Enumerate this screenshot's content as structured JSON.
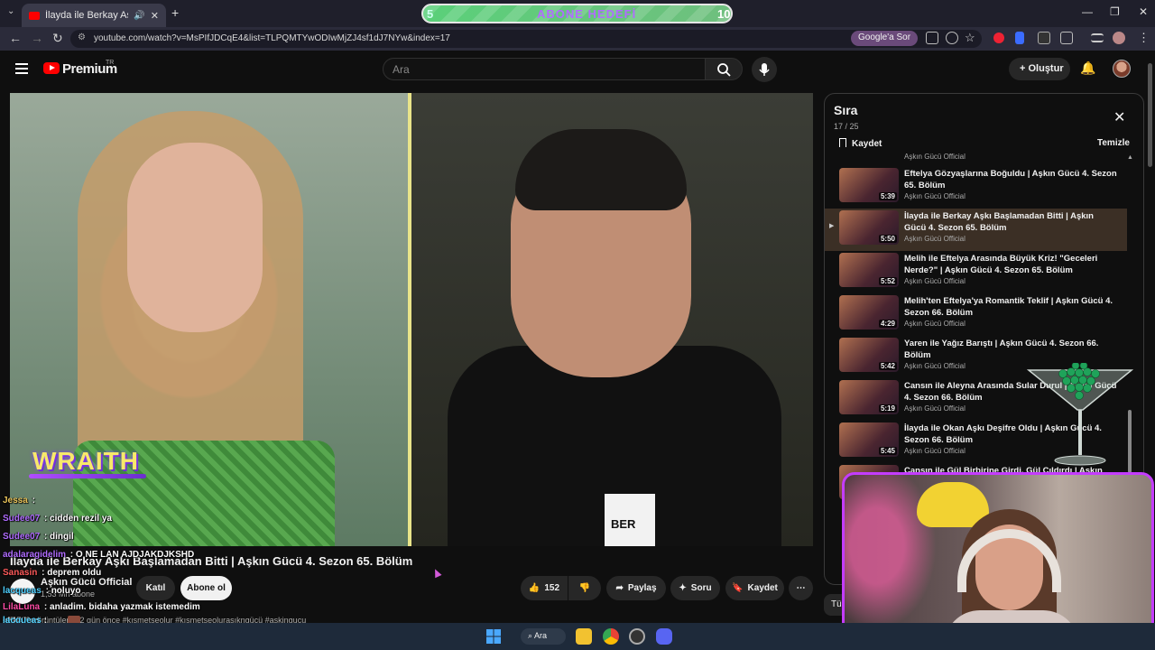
{
  "browser": {
    "tab_title": "İlayda ile Berkay Aşkı Başla",
    "url": "youtube.com/watch?v=MsPIfJDCqE4&list=TLPQMTYwODIwMjZJ4sf1dJ7NYw&index=17",
    "google_sor": "Google'a Sor"
  },
  "sub_goal": {
    "left": "5",
    "label": "ABONE HEDEFİ",
    "right": "10"
  },
  "header": {
    "logo": "Premium",
    "region": "TR",
    "search_placeholder": "Ara",
    "create_label": "Oluştur"
  },
  "video": {
    "title": "İlayda ile Berkay Aşkı Başlamadan Bitti | Aşkın Gücü 4. Sezon 65. Bölüm",
    "badge": "BER",
    "channel": "Aşkın Gücü Official",
    "subscribers": "1,53 Mn abone",
    "join_label": "Katıl",
    "subscribe_label": "Abone ol",
    "likes": "152",
    "share_label": "Paylaş",
    "ask_label": "Soru",
    "save_label": "Kaydet",
    "views_line": "5.702 görüntüleme  2 gün önce  #kısmetseolur #kısmetseolurasıkngücü #askingucu"
  },
  "queue": {
    "title": "Sıra",
    "count": "17 / 25",
    "save_label": "Kaydet",
    "clear_label": "Temizle",
    "top_channel": "Aşkın Gücü Official",
    "items": [
      {
        "title": "Eftelya Gözyaşlarına Boğuldu | Aşkın Gücü 4. Sezon 65. Bölüm",
        "duration": "5:39",
        "channel": "Aşkın Gücü Official",
        "active": false
      },
      {
        "title": "İlayda ile Berkay Aşkı Başlamadan Bitti | Aşkın Gücü 4. Sezon 65. Bölüm",
        "duration": "5:50",
        "channel": "Aşkın Gücü Official",
        "active": true
      },
      {
        "title": "Melih ile Eftelya Arasında Büyük Kriz! \"Geceleri Nerde?\" | Aşkın Gücü 4. Sezon 65. Bölüm",
        "duration": "5:52",
        "channel": "Aşkın Gücü Official",
        "active": false
      },
      {
        "title": "Melih'ten Eftelya'ya Romantik Teklif | Aşkın Gücü 4. Sezon 66. Bölüm",
        "duration": "4:29",
        "channel": "Aşkın Gücü Official",
        "active": false
      },
      {
        "title": "Yaren ile Yağız Barıştı | Aşkın Gücü 4. Sezon 66. Bölüm",
        "duration": "5:42",
        "channel": "Aşkın Gücü Official",
        "active": false
      },
      {
        "title": "Cansın ile Aleyna Arasında Sular Durul | Aşkın Gücü 4. Sezon 66. Bölüm",
        "duration": "5:19",
        "channel": "Aşkın Gücü Official",
        "active": false
      },
      {
        "title": "İlayda ile Okan Aşkı Deşifre Oldu | Aşkın Gücü 4. Sezon 66. Bölüm",
        "duration": "5:45",
        "channel": "Aşkın Gücü Official",
        "active": false
      },
      {
        "title": "Cansın ile Gül Birbirine Girdi, Gül Çıldırdı | Aşkın",
        "duration": "",
        "channel": "",
        "active": false
      }
    ]
  },
  "overlay": {
    "wraith": "WRAITH",
    "chat": [
      {
        "user": "Jessa",
        "message": "",
        "color": "#e8c25a"
      },
      {
        "user": "Sudee07",
        "message": "cidden rezil ya",
        "color": "#b06cff"
      },
      {
        "user": "Sudee07",
        "message": "dingil",
        "color": "#b06cff"
      },
      {
        "user": "adalaragidelim",
        "message": "O NE LAN AJDJAKDJKSHD",
        "color": "#b06cff"
      },
      {
        "user": "Sanasin",
        "message": "deprem oldu",
        "color": "#ff5a5a"
      },
      {
        "user": "lacqueas",
        "message": "noluyo",
        "color": "#4fd0ff"
      },
      {
        "user": "LilaLuna",
        "message": "anladim. bidaha yazmak istemedim",
        "color": "#ff4da6"
      },
      {
        "user": "shhahsg",
        "message": "",
        "color": "#ffffff"
      }
    ],
    "footer_user": "lacqueas",
    "tu_label": "Tü"
  },
  "taskbar": {
    "search": "Ara"
  },
  "colors": {
    "accent_red": "#ff0000",
    "active_row": "#3b2f25",
    "webcam_border": "#c43cff"
  }
}
